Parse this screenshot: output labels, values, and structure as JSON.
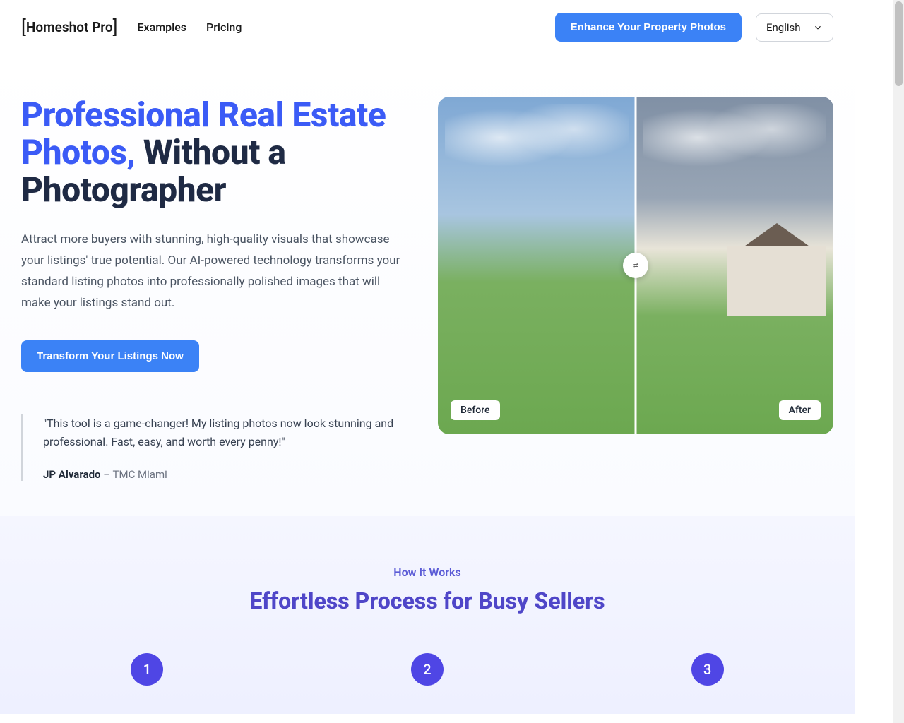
{
  "header": {
    "logo": "Homeshot Pro",
    "nav": {
      "examples": "Examples",
      "pricing": "Pricing"
    },
    "cta": "Enhance Your Property Photos",
    "language": "English"
  },
  "hero": {
    "title_accent": "Professional Real Estate Photos,",
    "title_rest": " Without a Photographer",
    "description": "Attract more buyers with stunning, high-quality visuals that showcase your listings' true potential. Our AI-powered technology transforms your standard listing photos into professionally polished images that will make your listings stand out.",
    "cta": "Transform Your Listings Now",
    "comparison": {
      "before_label": "Before",
      "after_label": "After"
    },
    "testimonial": {
      "quote": "\"This tool is a game-changer! My listing photos now look stunning and professional. Fast, easy, and worth every penny!\"",
      "author_name": "JP Alvarado",
      "author_suffix": " – TMC Miami"
    }
  },
  "how_it_works": {
    "eyebrow": "How It Works",
    "title": "Effortless Process for Busy Sellers",
    "steps": [
      "1",
      "2",
      "3"
    ]
  }
}
